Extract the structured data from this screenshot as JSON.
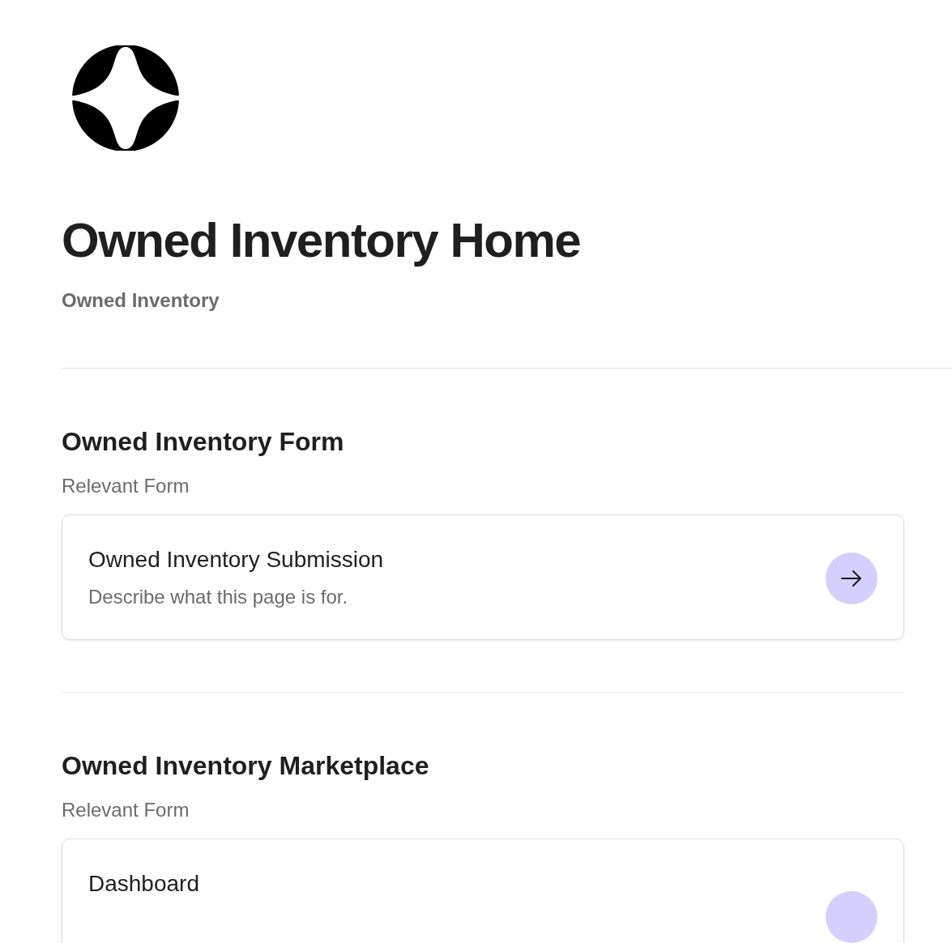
{
  "page": {
    "title": "Owned Inventory Home",
    "subtitle": "Owned Inventory"
  },
  "sections": [
    {
      "heading": "Owned Inventory Form",
      "caption": "Relevant Form",
      "cards": [
        {
          "title": "Owned Inventory Submission",
          "description": "Describe what this page is for."
        }
      ]
    },
    {
      "heading": "Owned Inventory Marketplace",
      "caption": "Relevant Form",
      "cards": [
        {
          "title": "Dashboard"
        }
      ]
    }
  ]
}
